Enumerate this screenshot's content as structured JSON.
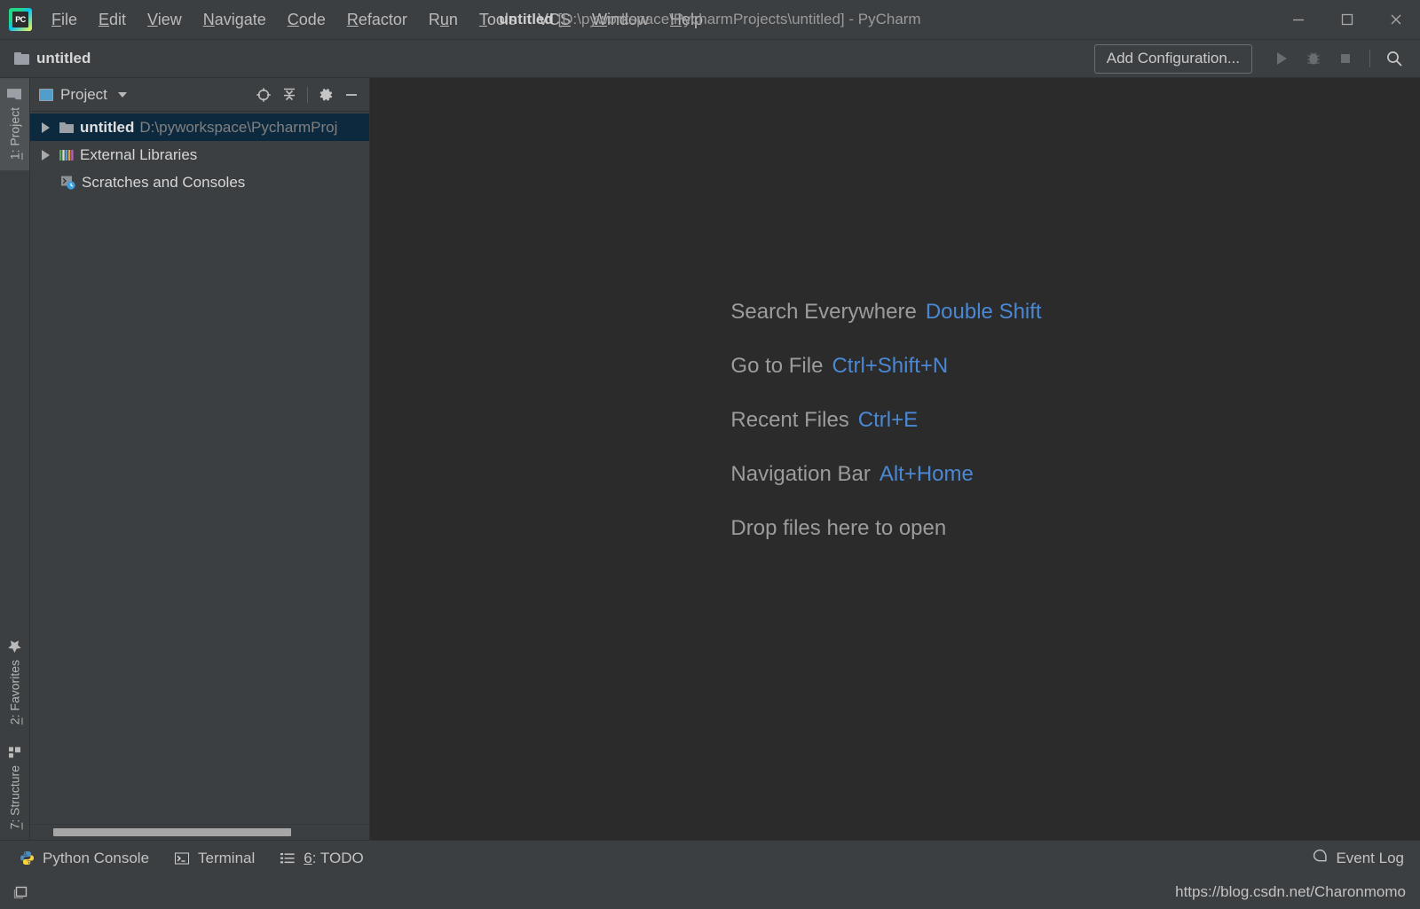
{
  "window": {
    "title_project": "untitled",
    "title_path": "[D:\\pyworkspace\\PycharmProjects\\untitled] - PyCharm",
    "app_logo": "pycharm-logo",
    "controls": {
      "minimize": "minimize-icon",
      "maximize": "maximize-icon",
      "close": "close-icon"
    }
  },
  "menubar": {
    "items": [
      {
        "label": "File",
        "pre": "",
        "mn": "F",
        "post": "ile"
      },
      {
        "label": "Edit",
        "pre": "",
        "mn": "E",
        "post": "dit"
      },
      {
        "label": "View",
        "pre": "",
        "mn": "V",
        "post": "iew"
      },
      {
        "label": "Navigate",
        "pre": "",
        "mn": "N",
        "post": "avigate"
      },
      {
        "label": "Code",
        "pre": "",
        "mn": "C",
        "post": "ode"
      },
      {
        "label": "Refactor",
        "pre": "",
        "mn": "R",
        "post": "efactor"
      },
      {
        "label": "Run",
        "pre": "R",
        "mn": "u",
        "post": "n"
      },
      {
        "label": "Tools",
        "pre": "",
        "mn": "T",
        "post": "ools"
      },
      {
        "label": "VCS",
        "pre": "VC",
        "mn": "S",
        "post": ""
      },
      {
        "label": "Window",
        "pre": "",
        "mn": "W",
        "post": "indow"
      },
      {
        "label": "Help",
        "pre": "",
        "mn": "H",
        "post": "elp"
      }
    ]
  },
  "navbar": {
    "breadcrumb": "untitled",
    "folder_icon": "folder-icon",
    "add_configuration": "Add Configuration...",
    "run_icon": "run-icon",
    "debug_icon": "debug-icon",
    "stop_icon": "stop-icon",
    "search_icon": "search-icon"
  },
  "left_stripe": {
    "top": [
      {
        "label": "1: Project",
        "pre": "",
        "mn": "1",
        "post": ": Project",
        "icon": "folder-icon",
        "active": true
      }
    ],
    "bottom": [
      {
        "label": "2: Favorites",
        "pre": "",
        "mn": "2",
        "post": ": Favorites",
        "icon": "star-icon",
        "active": false
      },
      {
        "label": "7: Structure",
        "pre": "",
        "mn": "7",
        "post": ": Structure",
        "icon": "structure-icon",
        "active": false
      }
    ]
  },
  "project_panel": {
    "title": "Project",
    "select_icon": "project-view-icon",
    "chevron_icon": "chevron-down-icon",
    "actions": [
      {
        "name": "locate-icon",
        "title": "Select Opened File"
      },
      {
        "name": "collapse-all-icon",
        "title": "Collapse All"
      },
      {
        "name": "gear-icon",
        "title": "Settings"
      },
      {
        "name": "hide-icon",
        "title": "Hide"
      }
    ],
    "tree": [
      {
        "label": "untitled",
        "path": "D:\\pyworkspace\\PycharmProj",
        "icon": "folder-icon",
        "arrow": "collapsed",
        "selected": true,
        "indent": false
      },
      {
        "label": "External Libraries",
        "path": "",
        "icon": "libraries-icon",
        "arrow": "collapsed",
        "selected": false,
        "indent": false
      },
      {
        "label": "Scratches and Consoles",
        "path": "",
        "icon": "scratches-icon",
        "arrow": "none",
        "selected": false,
        "indent": true
      }
    ],
    "scrollbar": "horizontal-scrollbar"
  },
  "editor_hints": [
    {
      "action": "Search Everywhere",
      "shortcut": "Double Shift"
    },
    {
      "action": "Go to File",
      "shortcut": "Ctrl+Shift+N"
    },
    {
      "action": "Recent Files",
      "shortcut": "Ctrl+E"
    },
    {
      "action": "Navigation Bar",
      "shortcut": "Alt+Home"
    },
    {
      "action": "Drop files here to open",
      "shortcut": ""
    }
  ],
  "bottom_bar": {
    "tabs": [
      {
        "label": "Python Console",
        "pre": "Python Console",
        "mn": "",
        "post": "",
        "icon": "python-icon"
      },
      {
        "label": "Terminal",
        "pre": "Terminal",
        "mn": "",
        "post": "",
        "icon": "terminal-icon"
      },
      {
        "label": "6: TODO",
        "pre": "",
        "mn": "6",
        "post": ": TODO",
        "icon": "todo-icon"
      }
    ],
    "event_log": "Event Log",
    "event_log_icon": "event-log-icon"
  },
  "status_bar": {
    "layout_icon": "layout-toggle-icon",
    "watermark": "https://blog.csdn.net/Charonmomo"
  },
  "colors": {
    "editor_bg": "#2b2b2b",
    "panel_bg": "#3c3f41",
    "selection_bg": "#0d293e",
    "accent_link": "#4a88d4",
    "text_primary": "#d6d6d6",
    "text_secondary": "#9c9c9c"
  }
}
